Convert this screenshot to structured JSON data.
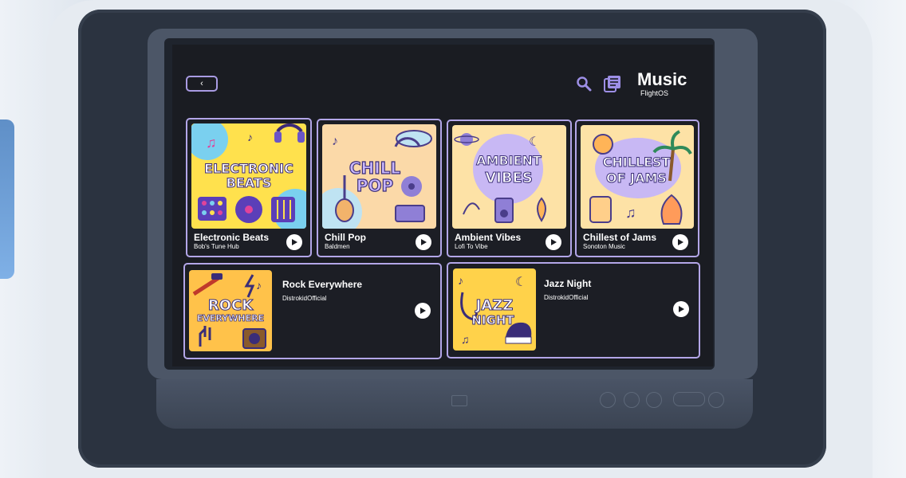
{
  "header": {
    "back_label": "‹",
    "app_title": "Music",
    "app_subtitle": "FlightOS",
    "icons": [
      "search-icon",
      "library-icon",
      "chevron-left-icon",
      "play-icon"
    ]
  },
  "albums": [
    {
      "title": "Electronic Beats",
      "artist": "Bob's Tune Hub",
      "art_line1": "ELECTRONIC",
      "art_line2": "BEATS"
    },
    {
      "title": "Chill Pop",
      "artist": "Baldmen",
      "art_line1": "CHILL",
      "art_line2": "POP"
    },
    {
      "title": "Ambient Vibes",
      "artist": "Lofi To Vibe",
      "art_line1": "AMBIENT",
      "art_line2": "VIBES"
    },
    {
      "title": "Chillest of Jams",
      "artist": "Sonoton Music",
      "art_line1": "CHILLEST",
      "art_line2": "OF JAMS"
    },
    {
      "title": "Rock Everywhere",
      "artist": "DistrokidOfficial",
      "art_line1": "ROCK",
      "art_line2": "EVERYWHERE"
    },
    {
      "title": "Jazz Night",
      "artist": "DistrokidOfficial",
      "art_line1": "JAZZ",
      "art_line2": "NIGHT"
    }
  ],
  "colors": {
    "accent": "#b3a6e8",
    "icon": "#9d8fe6",
    "background": "#1a1c22",
    "text": "#ffffff"
  }
}
